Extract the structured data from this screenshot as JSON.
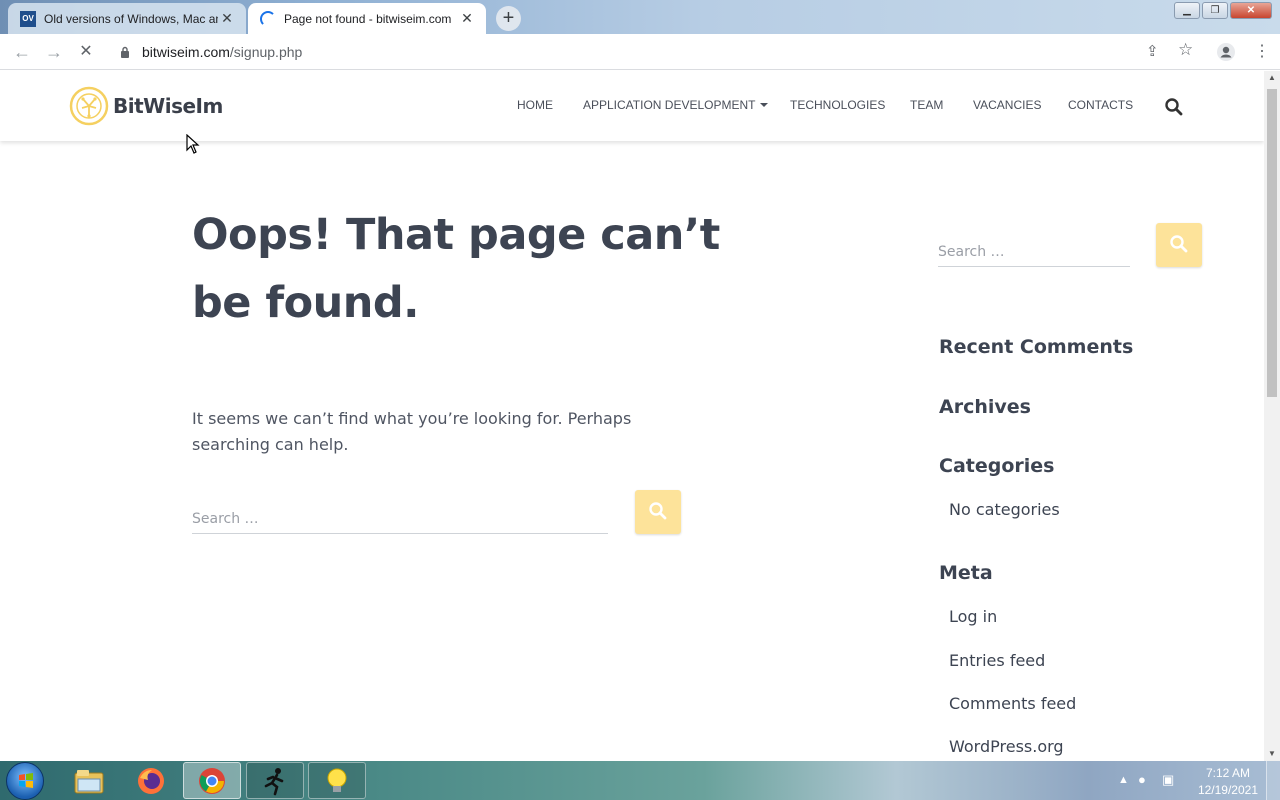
{
  "browser": {
    "tabs": [
      {
        "title": "Old versions of Windows, Mac and",
        "favicon": "ov-favicon",
        "favicon_text": "OV",
        "active": false
      },
      {
        "title": "Page not found - bitwiseim.com",
        "favicon": "loading-spinner",
        "active": true
      }
    ],
    "new_tab": "+",
    "window_controls": {
      "minimize": "▁",
      "maximize": "❐",
      "close": "✕"
    },
    "url": {
      "host": "bitwiseim.com",
      "path": "/signup.php"
    }
  },
  "site": {
    "logo_text": "BitWiseIm",
    "brand_color": "#f5d060",
    "nav": [
      {
        "label": "HOME"
      },
      {
        "label": "APPLICATION DEVELOPMENT",
        "dropdown": true
      },
      {
        "label": "TECHNOLOGIES"
      },
      {
        "label": "TEAM"
      },
      {
        "label": "VACANCIES"
      },
      {
        "label": "CONTACTS"
      }
    ]
  },
  "main": {
    "heading": "Oops! That page can’t be found.",
    "message": "It seems we can’t find what you’re looking for. Perhaps searching can help.",
    "search": {
      "placeholder": "Search …",
      "value": ""
    }
  },
  "sidebar": {
    "search": {
      "placeholder": "Search …",
      "value": ""
    },
    "recent_comments_title": "Recent Comments",
    "archives_title": "Archives",
    "categories_title": "Categories",
    "categories": [
      "No categories"
    ],
    "meta_title": "Meta",
    "meta_links": [
      "Log in",
      "Entries feed",
      "Comments feed",
      "WordPress.org"
    ]
  },
  "taskbar": {
    "apps": [
      "windows-explorer-icon",
      "firefox-icon",
      "chrome-icon",
      "runner-icon",
      "lightbulb-icon"
    ],
    "clock": {
      "time": "7:12 AM",
      "date": "12/19/2021"
    }
  }
}
